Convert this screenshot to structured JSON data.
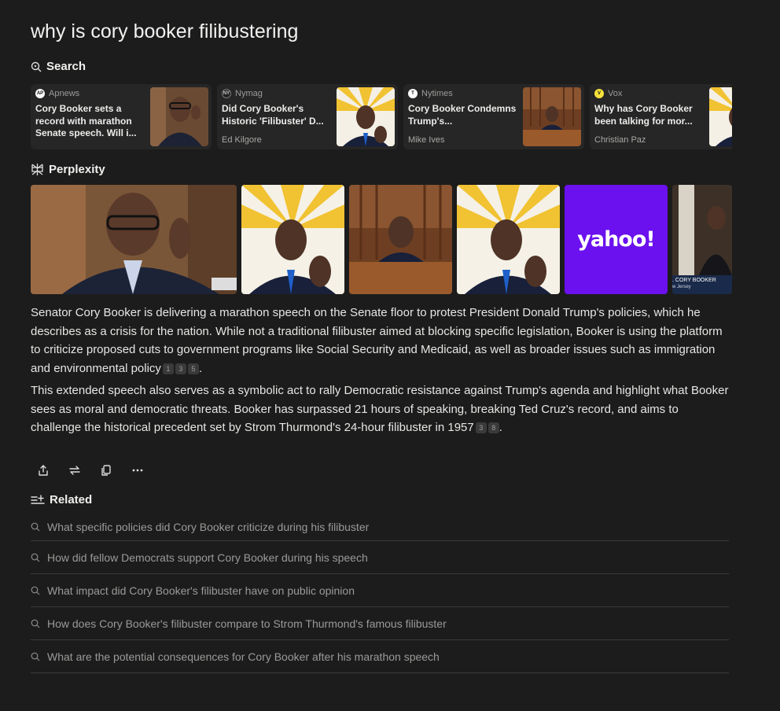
{
  "query": "why is cory booker filibustering",
  "search_heading": "Search",
  "perplexity_heading": "Perplexity",
  "related_heading": "Related",
  "sources": [
    {
      "site": "Apnews",
      "favicon": "AP",
      "title": "Cory Booker sets a record with marathon Senate speech. Will i...",
      "author": ""
    },
    {
      "site": "Nymag",
      "favicon": "NY",
      "title": "Did Cory Booker's Historic 'Filibuster' D...",
      "author": "Ed Kilgore"
    },
    {
      "site": "Nytimes",
      "favicon": "T",
      "title": "Cory Booker Condemns Trump's...",
      "author": "Mike Ives"
    },
    {
      "site": "Vox",
      "favicon": "V",
      "title": "Why has Cory Booker been talking for mor...",
      "author": "Christian Paz"
    }
  ],
  "image_labels": {
    "yahoo": "yahoo!",
    "chyron": ". CORY BOOKER",
    "chyron_sub": "w Jersey"
  },
  "answer": {
    "p1": "Senator Cory Booker is delivering a marathon speech on the Senate floor to protest President Donald Trump's policies, which he describes as a crisis for the nation. While not a traditional filibuster aimed at blocking specific legislation, Booker is using the platform to criticize proposed cuts to government programs like Social Security and Medicaid, as well as broader issues such as immigration and environmental policy",
    "p1_citations": [
      "1",
      "3",
      "5"
    ],
    "p2": "This extended speech also serves as a symbolic act to rally Democratic resistance against Trump's agenda and highlight what Booker sees as moral and democratic threats. Booker has surpassed 21 hours of speaking, breaking Ted Cruz's record, and aims to challenge the historical precedent set by Strom Thurmond's 24-hour filibuster in 1957",
    "p2_citations": [
      "3",
      "8"
    ]
  },
  "actions": [
    "share-icon",
    "rewrite-icon",
    "copy-icon",
    "more-icon"
  ],
  "related": [
    "What specific policies did Cory Booker criticize during his filibuster",
    "How did fellow Democrats support Cory Booker during his speech",
    "What impact did Cory Booker's filibuster have on public opinion",
    "How does Cory Booker's filibuster compare to Strom Thurmond's famous filibuster",
    "What are the potential consequences for Cory Booker after his marathon speech"
  ],
  "colors": {
    "background": "#1c1c1c",
    "card": "#262626",
    "yahoo": "#6b10ee"
  }
}
